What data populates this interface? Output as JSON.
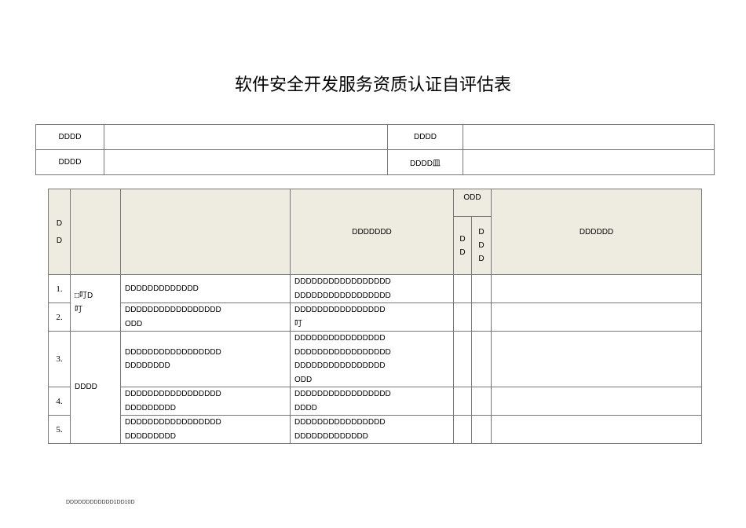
{
  "title": "软件安全开发服务资质认证自评估表",
  "info": {
    "r1c1": "DDDD",
    "r1c3": "DDDD",
    "r2c1": "DDDD",
    "r2c3": "DDDD皿"
  },
  "header": {
    "col1": [
      "D",
      "D"
    ],
    "col4": "DDDDDDD",
    "group": "ODD",
    "sub1": [
      "D",
      "D"
    ],
    "sub2": [
      "D",
      "D",
      "D"
    ],
    "col7": "DDDDDD"
  },
  "groups": [
    "□叮D",
    "叮",
    "DDDD"
  ],
  "rows": [
    {
      "num": "1.",
      "req": [
        "DDDDDDDDDDDDD"
      ],
      "desc": [
        "DDDDDDDDDDDDDDDDD",
        "DDDDDDDDDDDDDDDDD"
      ]
    },
    {
      "num": "2.",
      "req": [
        "DDDDDDDDDDDDDDDDD",
        "ODD"
      ],
      "desc": [
        "DDDDDDDDDDDDDDDD",
        "叮"
      ]
    },
    {
      "num": "3.",
      "req": [
        "DDDDDDDDDDDDDDDDD",
        "DDDDDDDD"
      ],
      "desc": [
        "DDDDDDDDDDDDDDDD",
        "DDDDDDDDDDDDDDDDD",
        "DDDDDDDDDDDDDDDD",
        "ODD"
      ]
    },
    {
      "num": "4.",
      "req": [
        "DDDDDDDDDDDDDDDDD",
        "DDDDDDDDD"
      ],
      "desc": [
        "DDDDDDDDDDDDDDDDD",
        "DDDD"
      ]
    },
    {
      "num": "5.",
      "req": [
        "DDDDDDDDDDDDDDDDD",
        "DDDDDDDDD"
      ],
      "desc": [
        "DDDDDDDDDDDDDDDD",
        "DDDDDDDDDDDDD"
      ]
    }
  ],
  "footer": "DDDDDDDDDDDD1DD10D"
}
